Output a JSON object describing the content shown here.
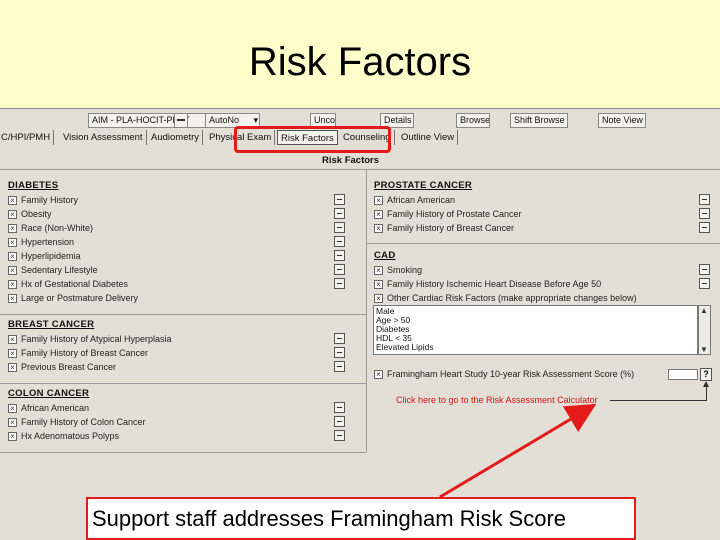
{
  "slide_title": "Risk Factors",
  "toolbar": {
    "combo": "AIM - PLA-HOCIT-PLNT",
    "autonote": "AutoNo",
    "undo": "Unco",
    "details": "Details",
    "browse": "Browse",
    "shift_browse": "Shift Browse",
    "note_view": "Note View"
  },
  "tabs": [
    "C/HPI/PMH",
    "Vision Assessment",
    "Audiometry",
    "Physical Exam",
    "Risk Factors",
    "Counseling",
    "Outline View"
  ],
  "panel_title": "Risk Factors",
  "diabetes": {
    "title": "DIABETES",
    "items": [
      "Family History",
      "Obesity",
      "Race (Non-White)",
      "Hypertension",
      "Hyperlipidemia",
      "Sedentary Lifestyle",
      "Hx of Gestational Diabetes",
      "Large or Postmature Delivery"
    ]
  },
  "breast_cancer": {
    "title": "BREAST CANCER",
    "items": [
      "Family History of Atypical Hyperplasia",
      "Family History of Breast Cancer",
      "Previous Breast Cancer"
    ]
  },
  "colon_cancer": {
    "title": "COLON CANCER",
    "items": [
      "African American",
      "Family History of Colon Cancer",
      "Hx Adenomatous Polyps"
    ]
  },
  "prostate_cancer": {
    "title": "PROSTATE CANCER",
    "items": [
      "African American",
      "Family History of Prostate Cancer",
      "Family History of Breast Cancer"
    ]
  },
  "cad": {
    "title": "CAD",
    "items": [
      "Smoking",
      "Family History Ischemic Heart Disease Before Age 50",
      "Other Cardiac Risk Factors (make appropriate changes below)"
    ],
    "notes": [
      "Male",
      "Age > 50",
      "Diabetes",
      "HDL < 35",
      "Elevated Lipids"
    ],
    "framingham_label": "Framingham Heart Study 10-year Risk Assessment Score (%)",
    "help": "?"
  },
  "risk_link": "Click here to go to the Risk Assessment Calculator",
  "callout": "Support staff addresses Framingham Risk Score",
  "colors": {
    "slide_bg": "#fffecb",
    "app_bg": "#e3dfd6",
    "accent_red": "#e41b1b"
  }
}
